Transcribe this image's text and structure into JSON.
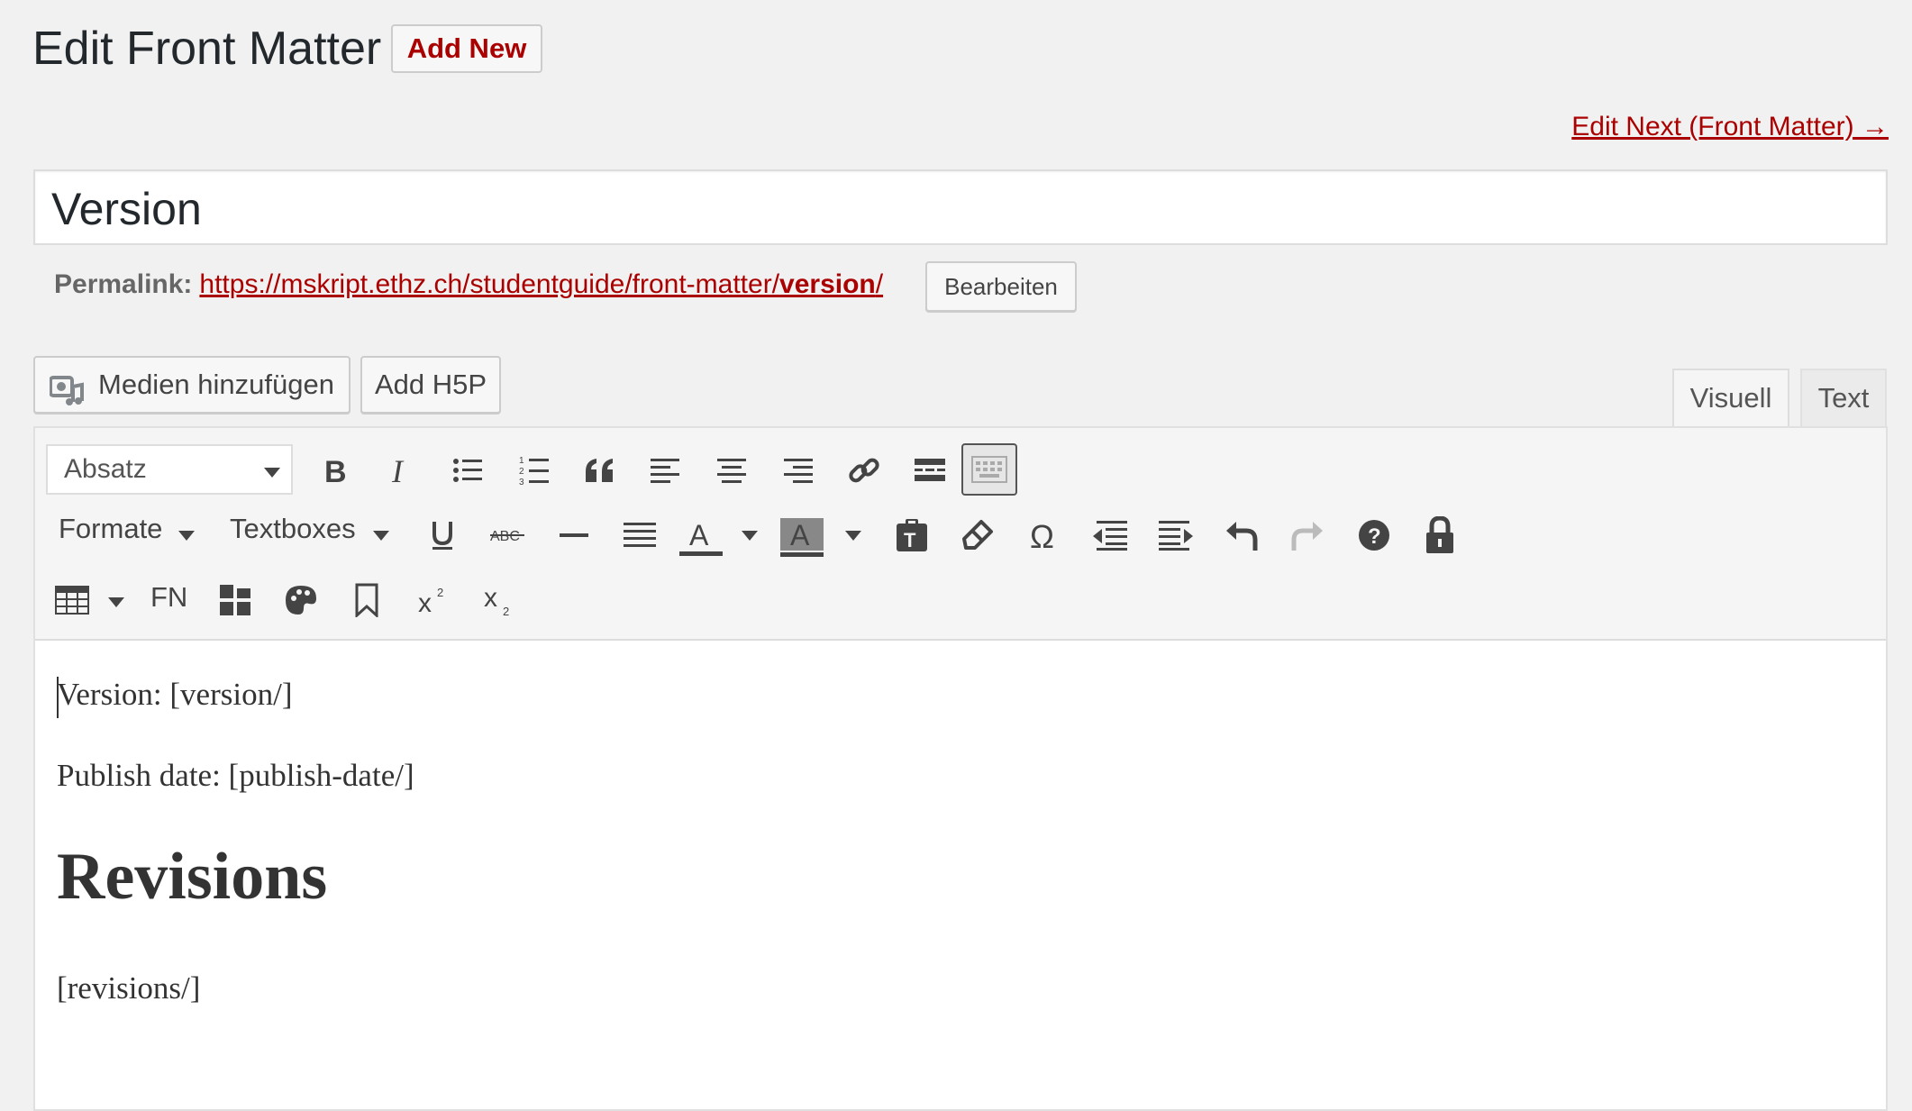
{
  "header": {
    "title": "Edit Front Matter",
    "add_new": "Add New",
    "edit_next": "Edit Next (Front Matter) →"
  },
  "post": {
    "title": "Version"
  },
  "permalink": {
    "label": "Permalink:",
    "url_base": "https://mskript.ethz.ch/studentguide/front-matter/",
    "slug": "version",
    "trailing": "/",
    "edit_button": "Bearbeiten"
  },
  "media": {
    "add_media": "Medien hinzufügen",
    "add_h5p": "Add H5P"
  },
  "tabs": {
    "visual": "Visuell",
    "text": "Text"
  },
  "toolbar": {
    "format_select": "Absatz",
    "formats_menu": "Formate",
    "textboxes_menu": "Textboxes",
    "footnote": "FN"
  },
  "content": {
    "line1": "Version: [version/]",
    "line2": "Publish date: [publish-date/]",
    "heading": "Revisions",
    "line3": "[revisions/]"
  },
  "colors": {
    "accent": "#aa0000",
    "background": "#f1f1f1",
    "toolbar": "#f5f5f5"
  }
}
